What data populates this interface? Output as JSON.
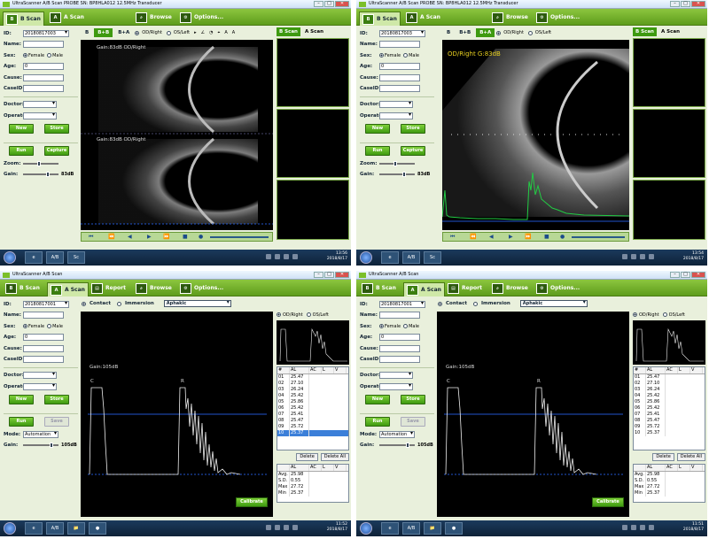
{
  "window_title": "UltraScanner A/B Scan",
  "probe_title": "UltraScanner A/B Scan  PROBE SN: BP8HLA012 12.5MHz Transducer",
  "window_buttons": {
    "minimize": "–",
    "maximize": "□",
    "close": "✕"
  },
  "toolbar": {
    "b_scan": "B Scan",
    "a_scan": "A Scan",
    "report": "Report",
    "browse": "Browse",
    "options": "Options...",
    "b_icon": "B",
    "a_icon": "A"
  },
  "form": {
    "id_label": "ID:",
    "name_label": "Name:",
    "sex_label": "Sex:",
    "female": "Female",
    "male": "Male",
    "age_label": "Age:",
    "age_value": "0",
    "cause_label": "Cause:",
    "caseid_label": "CaseID:",
    "doctor_label": "Doctor:",
    "operator_label": "Operator:",
    "new_button": "New",
    "store_button": "Store",
    "run_button": "Run",
    "capture_button": "Capture",
    "save_button": "Save",
    "zoom_label": "Zoom:",
    "gain_label": "Gain:",
    "mode_label": "Mode:",
    "mode_value": "Automation"
  },
  "quads": [
    {
      "id_value": "20180817003",
      "gain_value": "83dB",
      "view_tabs": [
        "B",
        "B+B",
        "B+A"
      ],
      "active_view": "B+B",
      "eye_od": "OD/Right",
      "eye_os": "OS/Left",
      "tool_icons": [
        "▸",
        "∠",
        "◔",
        "⌖",
        "A",
        "A"
      ],
      "overlay_1": "Gain:83dB      OD/Right",
      "overlay_2": "Gain:83dB      OD/Right",
      "right_tabs": [
        "B Scan",
        "A Scan"
      ],
      "taskbar_apps": [
        "e",
        "A/B",
        "Sc"
      ],
      "clock_time": "13:56",
      "clock_date": "2018/8/17"
    },
    {
      "id_value": "20180817003",
      "gain_value": "83dB",
      "view_tabs": [
        "B",
        "B+B",
        "B+A"
      ],
      "active_view": "B+A",
      "eye_od": "OD/Right",
      "eye_os": "OS/Left",
      "overlay_1": "OD/Right    G:83dB",
      "right_tabs": [
        "B Scan",
        "A Scan"
      ],
      "taskbar_apps": [
        "e",
        "A/B",
        "Sc"
      ],
      "clock_time": "13:54",
      "clock_date": "2018/8/17"
    },
    {
      "id_value": "20180817001",
      "gain_value": "105dB",
      "contact": "Contact",
      "immersion": "Immersion",
      "lens": "Aphakic",
      "overlay_1": "Gain:105dB",
      "peak_c": "C",
      "peak_r": "R",
      "eye_od": "OD/Right",
      "eye_os": "OS/Left",
      "table_headers": [
        "#",
        "AL",
        "AC",
        "L",
        "V"
      ],
      "table_rows": [
        [
          "01",
          "25.47"
        ],
        [
          "02",
          "27.10"
        ],
        [
          "03",
          "26.24"
        ],
        [
          "04",
          "25.42"
        ],
        [
          "05",
          "25.86"
        ],
        [
          "06",
          "25.42"
        ],
        [
          "07",
          "25.41"
        ],
        [
          "08",
          "25.47"
        ],
        [
          "09",
          "25.72"
        ],
        [
          "10",
          "25.37"
        ]
      ],
      "selected_row": 9,
      "delete": "Delete",
      "delete_all": "Delete All",
      "stats": [
        [
          "Avg.",
          "25.98"
        ],
        [
          "S.D.",
          "0.55"
        ],
        [
          "Max",
          "27.72"
        ],
        [
          "Min",
          "25.37"
        ]
      ],
      "calibrate": "Calibrate",
      "taskbar_apps": [
        "e",
        "A/B",
        "📁",
        "●"
      ],
      "clock_time": "11:52",
      "clock_date": "2018/8/17"
    },
    {
      "id_value": "20180817001",
      "gain_value": "105dB",
      "contact": "Contact",
      "immersion": "Immersion",
      "lens": "Aphakic",
      "overlay_1": "Gain:105dB",
      "peak_c": "C",
      "peak_r": "R",
      "eye_od": "OD/Right",
      "eye_os": "OS/Left",
      "table_headers": [
        "#",
        "AL",
        "AC",
        "L",
        "V"
      ],
      "table_rows": [
        [
          "01",
          "25.47"
        ],
        [
          "02",
          "27.10"
        ],
        [
          "03",
          "26.24"
        ],
        [
          "04",
          "25.42"
        ],
        [
          "05",
          "25.86"
        ],
        [
          "06",
          "25.42"
        ],
        [
          "07",
          "25.41"
        ],
        [
          "08",
          "25.47"
        ],
        [
          "09",
          "25.72"
        ],
        [
          "10",
          "25.37"
        ]
      ],
      "delete": "Delete",
      "delete_all": "Delete All",
      "stats": [
        [
          "Avg.",
          "25.98"
        ],
        [
          "S.D.",
          "0.55"
        ],
        [
          "Max",
          "27.72"
        ],
        [
          "Min",
          "25.37"
        ]
      ],
      "calibrate": "Calibrate",
      "taskbar_apps": [
        "e",
        "A/B",
        "📁",
        "●"
      ],
      "clock_time": "11:51",
      "clock_date": "2018/8/17"
    }
  ],
  "colors": {
    "toolbar_green": "#6aaa22",
    "button_green": "#3e9a10",
    "echo_green": "#22cc44",
    "baseline_blue": "#2255cc",
    "overlay_yellow": "#e8d020"
  }
}
